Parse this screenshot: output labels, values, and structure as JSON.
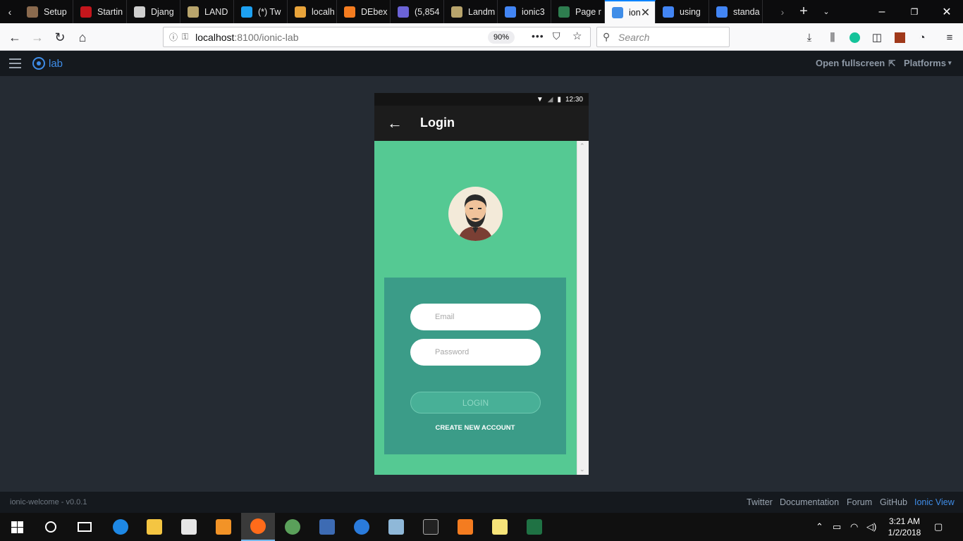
{
  "tabs": [
    {
      "label": "Setup",
      "icon": "avatar-favicon-icon",
      "color": "#8a6a4e"
    },
    {
      "label": "Startin",
      "icon": "rd-favicon-icon",
      "color": "#c4161c"
    },
    {
      "label": "Djang",
      "icon": "django-favicon-icon",
      "color": "#cfcfcf"
    },
    {
      "label": "LAND",
      "icon": "landmark-favicon-icon",
      "color": "#b8a46c"
    },
    {
      "label": "(*) Tw",
      "icon": "twitter-icon",
      "color": "#1da1f2"
    },
    {
      "label": "localh",
      "icon": "localhost-favicon-icon",
      "color": "#e8a33a"
    },
    {
      "label": "DEbex",
      "icon": "xampp-favicon-icon",
      "color": "#f47c20"
    },
    {
      "label": "(5,854",
      "icon": "mail-favicon-icon",
      "color": "#6b63d6"
    },
    {
      "label": "Landm",
      "icon": "landmark-favicon-icon",
      "color": "#b8a46c"
    },
    {
      "label": "ionic3",
      "icon": "google-icon",
      "color": "#4285f4"
    },
    {
      "label": "Page r",
      "icon": "page-favicon-icon",
      "color": "#2e7d4f"
    },
    {
      "label": "ion",
      "icon": "ionic-favicon-icon",
      "color": "#3f8de8",
      "active": true
    },
    {
      "label": "using",
      "icon": "google-icon",
      "color": "#4285f4"
    },
    {
      "label": "standa",
      "icon": "google-icon",
      "color": "#4285f4"
    }
  ],
  "url": {
    "host": "localhost",
    "path": ":8100/ionic-lab",
    "zoom": "90%"
  },
  "search_placeholder": "Search",
  "lab": {
    "logo_text": "lab",
    "open_fullscreen": "Open fullscreen",
    "platforms": "Platforms"
  },
  "phone": {
    "status_time": "12:30",
    "title": "Login",
    "email_placeholder": "Email",
    "password_placeholder": "Password",
    "login_button": "LOGIN",
    "create_account": "CREATE NEW ACCOUNT",
    "colors": {
      "bg": "#55c993",
      "card": "#3b9c88"
    }
  },
  "footer": {
    "version": "ionic-welcome - v0.0.1",
    "links": [
      "Twitter",
      "Documentation",
      "Forum",
      "GitHub",
      "Ionic View"
    ]
  },
  "taskbar": {
    "time": "3:21 AM",
    "date": "1/2/2018"
  }
}
